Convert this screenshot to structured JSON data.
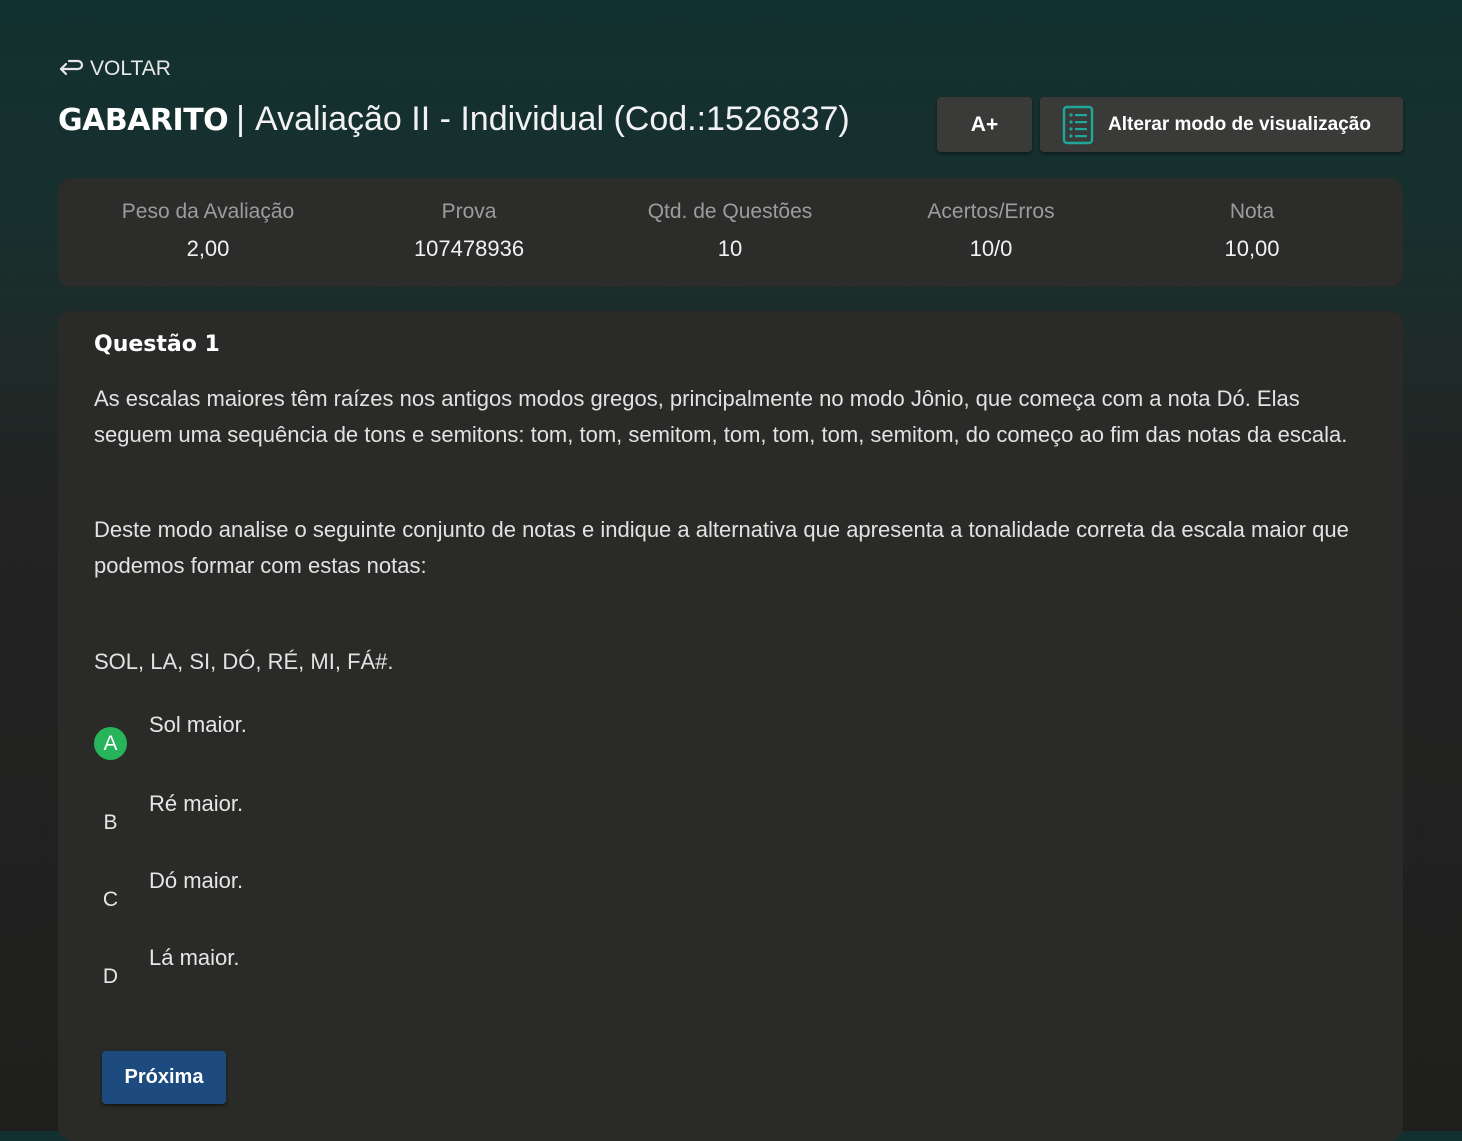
{
  "nav": {
    "back_label": "VOLTAR",
    "back_icon": "return-arrow-icon"
  },
  "header": {
    "title_strong": "GABARITO",
    "separator": "|",
    "title_rest": "Avaliação II - Individual (Cod.:1526837)",
    "font_button_label": "A+",
    "view_mode_button_label": "Alterar modo de visualização",
    "view_mode_icon": "list-document-icon"
  },
  "summary": {
    "items": [
      {
        "label": "Peso da Avaliação",
        "value": "2,00"
      },
      {
        "label": "Prova",
        "value": "107478936"
      },
      {
        "label": "Qtd. de Questões",
        "value": "10"
      },
      {
        "label": "Acertos/Erros",
        "value": "10/0"
      },
      {
        "label": "Nota",
        "value": "10,00"
      }
    ]
  },
  "question": {
    "title": "Questão 1",
    "paragraph_1": "As escalas maiores têm raízes nos antigos modos gregos, principalmente no modo Jônio, que começa com a nota Dó. Elas seguem uma sequência de tons e semitons: tom, tom, semitom, tom, tom, tom, semitom, do começo ao fim das notas da escala.",
    "paragraph_2": "Deste modo analise o seguinte conjunto de notas e indique a alternativa que apresenta a tonalidade correta da escala maior que podemos formar com estas notas:",
    "notes": "SOL, LA, SI, DÓ, RÉ, MI, FÁ#.",
    "options": [
      {
        "letter": "A",
        "text": "Sol maior.",
        "correct": true
      },
      {
        "letter": "B",
        "text": "Ré maior.",
        "correct": false
      },
      {
        "letter": "C",
        "text": "Dó maior.",
        "correct": false
      },
      {
        "letter": "D",
        "text": "Lá maior.",
        "correct": false
      }
    ],
    "next_button_label": "Próxima"
  },
  "colors": {
    "correct": "#27b45a",
    "primary_button": "#1d4b7f",
    "card_bg": "#2a2a28",
    "accent_icon": "#1fa89a"
  }
}
